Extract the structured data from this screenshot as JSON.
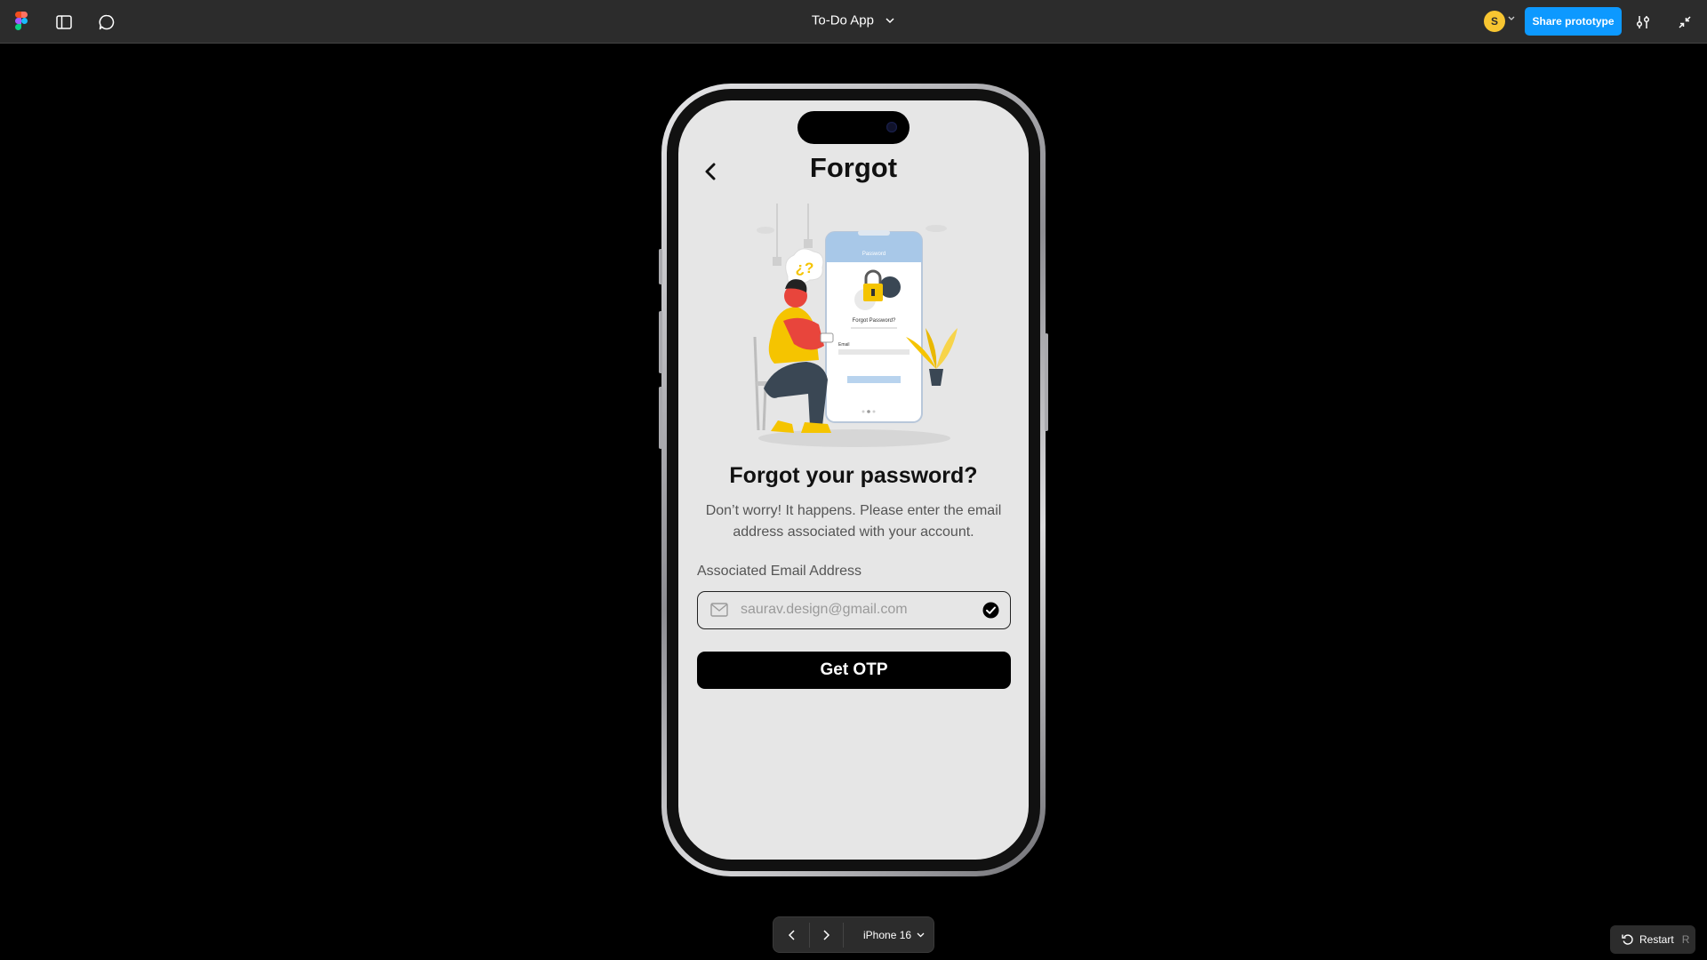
{
  "toolbar": {
    "file_title": "To-Do App",
    "avatar_initial": "S",
    "share_label": "Share prototype"
  },
  "screen": {
    "title": "Forgot",
    "heading": "Forgot your password?",
    "description": "Don’t worry! It happens. Please enter the email address associated with your account.",
    "email_label": "Associated Email Address",
    "email_value": "saurav.design@gmail.com",
    "button_label": "Get OTP"
  },
  "illustration": {
    "app_bar": "Password",
    "card_title": "Forgot Password?",
    "email_label": "Email",
    "bubble": "¿?"
  },
  "footer": {
    "device": "iPhone 16",
    "restart_label": "Restart",
    "restart_key": "R"
  },
  "colors": {
    "toolbar_bg": "#2c2c2c",
    "accent": "#0d99ff",
    "avatar": "#f7c531",
    "screen_bg": "#e6e6e6"
  }
}
